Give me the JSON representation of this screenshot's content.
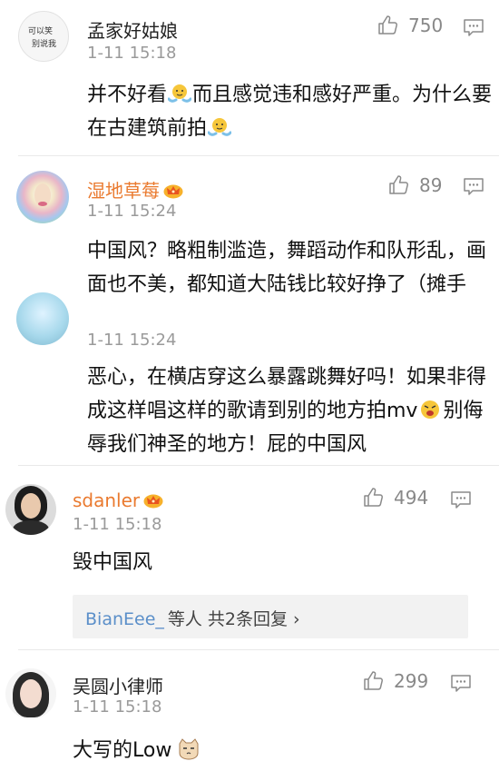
{
  "comments": [
    {
      "username": "孟家好姑娘",
      "avatar_text_1": "可以笑",
      "avatar_text_2": "别说我",
      "timestamp": "1-11 15:18",
      "likes": "750",
      "text_parts": [
        "并不好看",
        "而且感觉违和感好严重。为什么要在古建筑前拍",
        ""
      ]
    },
    {
      "username": "湿地草莓",
      "timestamp": "1-11 15:24",
      "likes": "89",
      "text": "中国风？略粗制滥造，舞蹈动作和队形乱，画面也不美，都知道大陆钱比较好挣了（摊手"
    },
    {
      "timestamp": "1-11 15:24",
      "text_parts": [
        "恶心，在横店穿这么暴露跳舞好吗！如果非得成这样唱这样的歌请到别的地方拍mv",
        "别侮辱我们神圣的地方！屁的中国风"
      ]
    },
    {
      "username": "sdanler",
      "timestamp": "1-11 15:18",
      "likes": "494",
      "text": "毁中国风",
      "reply_user": "BianEee_",
      "reply_rest": "等人  共2条回复  ›"
    },
    {
      "username": "吴圆小律师",
      "timestamp": "1-11 15:18",
      "likes": "299",
      "text": "大写的Low"
    }
  ],
  "colors": {
    "vip_name": "#ea7a2f",
    "reply_user": "#5b8fc9",
    "timestamp": "#9a9a9a"
  },
  "icons": [
    "thumbs-up-icon",
    "comment-reply-icon",
    "crown-vip-icon",
    "shrug-emoji",
    "angry-emoji",
    "cat-emoji"
  ]
}
